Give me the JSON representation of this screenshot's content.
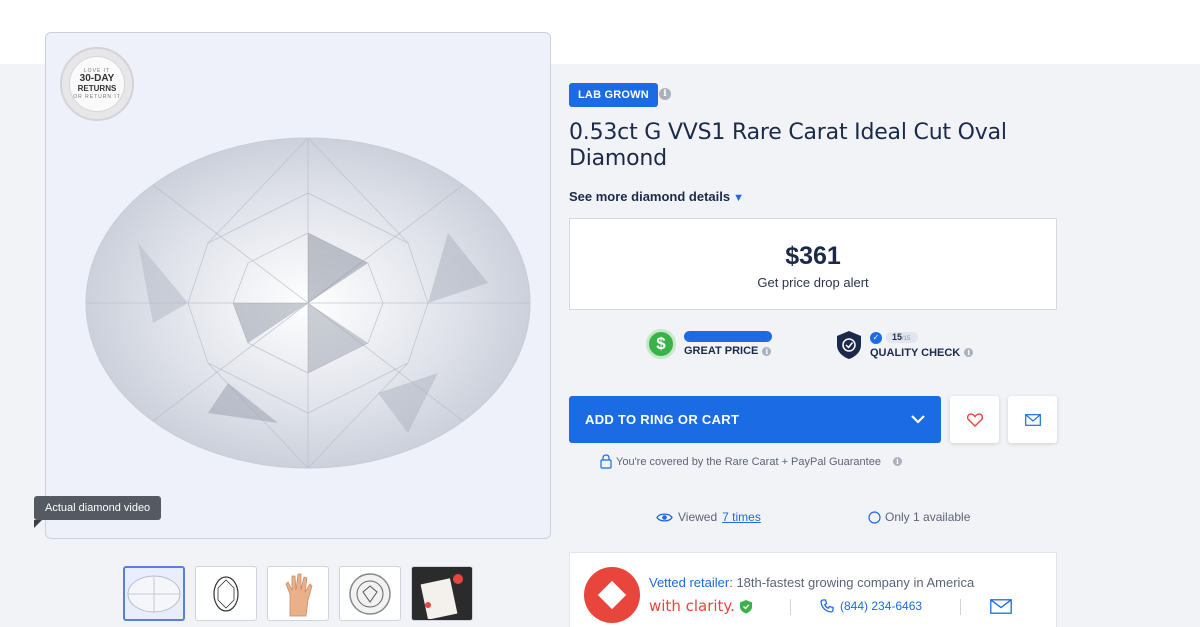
{
  "media": {
    "seal": {
      "top": "LOVE IT",
      "main_line1": "30-DAY",
      "main_line2": "RETURNS",
      "bottom": "OR RETURN IT"
    },
    "video_label": "Actual diamond video",
    "thumbnails": [
      "diamond-image",
      "diamond-outline-diagram",
      "diamond-on-hand",
      "certificate-seal",
      "certificate-document"
    ]
  },
  "badge": {
    "label": "LAB GROWN",
    "info_icon": "info-icon"
  },
  "product": {
    "title": "0.53ct G VVS1 Rare Carat Ideal Cut Oval Diamond",
    "see_more": "See more diamond details"
  },
  "pricing": {
    "price": "$361",
    "alert_label": "Get price drop alert"
  },
  "metrics": {
    "great_price": {
      "label": "GREAT PRICE",
      "level": 1.0,
      "icon": "dollar-icon"
    },
    "quality_check": {
      "label": "QUALITY CHECK",
      "score": "15",
      "score_max": "/15",
      "icon": "shield-check-icon"
    }
  },
  "actions": {
    "cart_label": "ADD TO RING OR CART",
    "guarantee": "You're covered by the Rare Carat + PayPal Guarantee"
  },
  "stats": {
    "viewed_prefix": "Viewed",
    "viewed_link": "7 times",
    "availability": "Only 1 available"
  },
  "retailer": {
    "vetted_label": "Vetted retailer",
    "vetted_text": ": 18th-fastest growing company in America",
    "brand": "with clarity.",
    "phone": "(844) 234-6463"
  },
  "colors": {
    "accent": "#1a6be4",
    "navy": "#1b2a4a",
    "green": "#3bb14a",
    "brand_red": "#e8453c"
  }
}
